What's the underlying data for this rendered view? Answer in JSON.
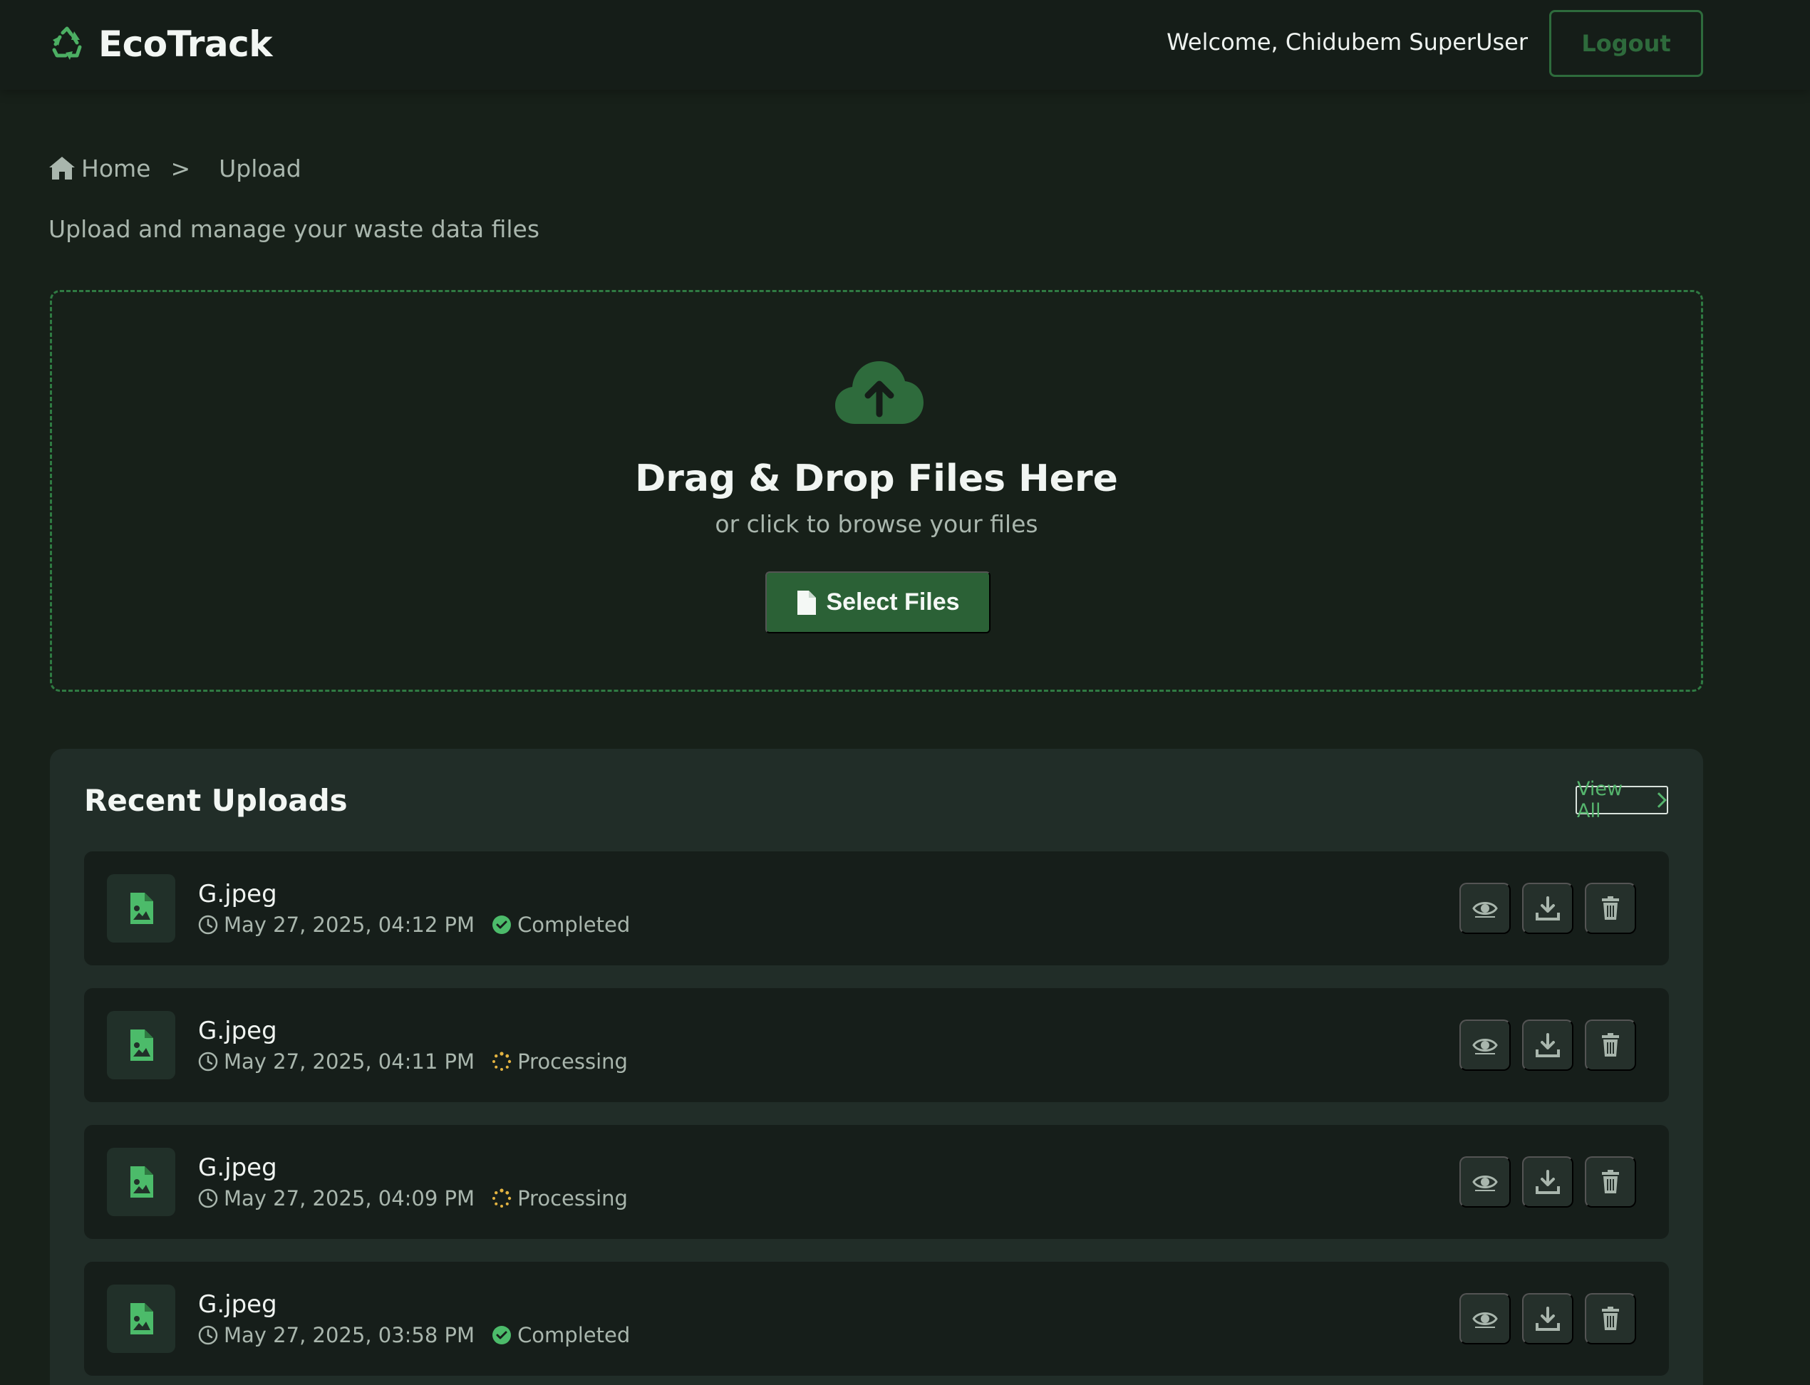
{
  "header": {
    "brand": "EcoTrack",
    "welcome": "Welcome, Chidubem SuperUser",
    "logout_label": "Logout"
  },
  "breadcrumb": {
    "home": "Home",
    "separator": ">",
    "current": "Upload"
  },
  "subtitle": "Upload and manage your waste data files",
  "dropzone": {
    "title": "Drag & Drop Files Here",
    "subtitle": "or click to browse your files",
    "button_label": "Select Files"
  },
  "recent": {
    "title": "Recent Uploads",
    "view_all": "View All",
    "items": [
      {
        "name": "G.jpeg",
        "date": "May 27, 2025, 04:12 PM",
        "status": "Completed"
      },
      {
        "name": "G.jpeg",
        "date": "May 27, 2025, 04:11 PM",
        "status": "Processing"
      },
      {
        "name": "G.jpeg",
        "date": "May 27, 2025, 04:09 PM",
        "status": "Processing"
      },
      {
        "name": "G.jpeg",
        "date": "May 27, 2025, 03:58 PM",
        "status": "Completed"
      }
    ]
  },
  "colors": {
    "accent": "#2e6b3c",
    "brand_green": "#55b56d",
    "completed": "#4cbb6a",
    "processing": "#e3b341",
    "background": "#172019"
  },
  "icons": {
    "logo": "recycle-icon",
    "home": "home-icon",
    "upload": "cloud-upload-icon",
    "select": "file-icon",
    "file": "image-file-icon",
    "time": "clock-icon",
    "completed": "check-circle-icon",
    "processing": "spinner-icon",
    "view": "eye-icon",
    "download": "download-icon",
    "delete": "trash-icon"
  }
}
